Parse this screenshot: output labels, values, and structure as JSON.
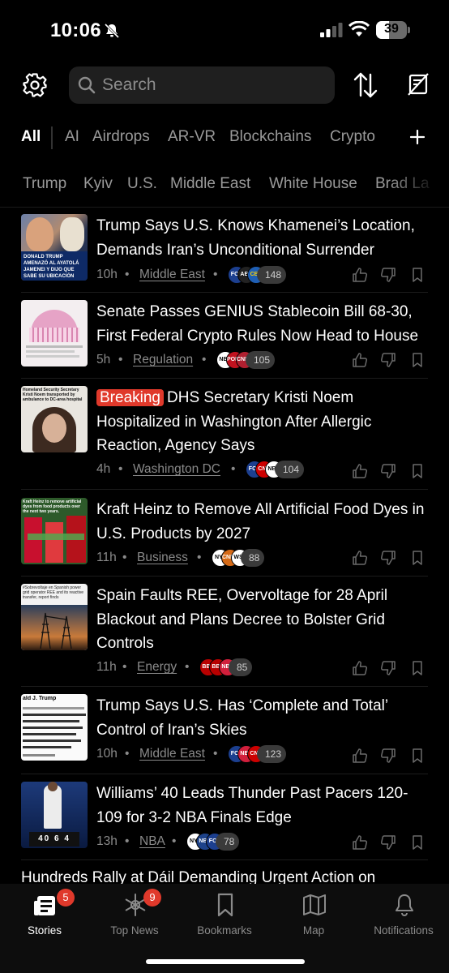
{
  "status_bar": {
    "time": "10:06",
    "battery": "39"
  },
  "search": {
    "placeholder": "Search"
  },
  "tabs": [
    "All",
    "AI",
    "Airdrops",
    "AR-VR",
    "Blockchains",
    "Crypto"
  ],
  "chips": [
    "Trump",
    "Kyiv",
    "U.S.",
    "Middle East",
    "White House",
    "Brad La"
  ],
  "stories": [
    {
      "badge": "",
      "headline": "Trump Says U.S. Knows Khamenei’s Location, Demands Iran’s Unconditional Surrender",
      "age": "10h",
      "topic": "Middle East",
      "sources": [
        "FOX",
        "ABC",
        "CBS"
      ],
      "source_count": "148",
      "thumb_caption": "DONALD TRUMP AMENAZÓ AL AYATOLÁ JAMENEI Y DIJO QUE SABE SU UBICACIÓN"
    },
    {
      "badge": "",
      "headline": "Senate Passes GENIUS Stablecoin Bill 68-30, First Federal Crypto Rules Now Head to House",
      "age": "5h",
      "topic": "Regulation",
      "sources": [
        "NBC",
        "POLIT",
        "CNBC"
      ],
      "source_count": "105",
      "thumb_caption": ""
    },
    {
      "badge": "Breaking",
      "headline": "DHS Secretary Kristi Noem Hospitalized in Washington After Allergic Reaction, Agency Says",
      "age": "4h",
      "topic": "Washington DC",
      "sources": [
        "FOX",
        "CNN",
        "NBC"
      ],
      "source_count": "104",
      "thumb_caption": "Homeland Security Secretary Kristi Noem transported by ambulance to DC-area hospital"
    },
    {
      "badge": "",
      "headline": "Kraft Heinz to Remove All Artificial Food Dyes in U.S. Products by 2027",
      "age": "11h",
      "topic": "Business",
      "sources": [
        "NYT",
        "CNBC",
        "WSJ"
      ],
      "source_count": "88",
      "thumb_caption": "Kraft Heinz to remove artificial dyes from food products over the next two years."
    },
    {
      "badge": "",
      "headline": "Spain Faults REE, Overvoltage for 28 April Blackout and Plans Decree to Bolster Grid Controls",
      "age": "11h",
      "topic": "Energy",
      "sources": [
        "BBC",
        "BBC",
        "NBC"
      ],
      "source_count": "85",
      "thumb_caption": "#Sobrevoltaje en Spanish power grid operator REE and its reactive transfer, report finds"
    },
    {
      "badge": "",
      "headline": "Trump Says U.S. Has ‘Complete and Total’ Control of Iran’s Skies",
      "age": "10h",
      "topic": "Middle East",
      "sources": [
        "FOX",
        "NBC",
        "CNN"
      ],
      "source_count": "123",
      "thumb_caption": "ald J. Trump"
    },
    {
      "badge": "",
      "headline": "Williams’ 40 Leads Thunder Past Pacers 120-109 for 3-2 NBA Finals Edge",
      "age": "13h",
      "topic": "NBA",
      "sources": [
        "NYT",
        "NBA",
        "FOX"
      ],
      "source_count": "78",
      "thumb_caption": "40 6 4"
    }
  ],
  "teaser": "Hundreds Rally at Dáil Demanding Urgent Action on",
  "tabbar": [
    {
      "label": "Stories",
      "badge": "5"
    },
    {
      "label": "Top News",
      "badge": "9"
    },
    {
      "label": "Bookmarks",
      "badge": ""
    },
    {
      "label": "Map",
      "badge": ""
    },
    {
      "label": "Notifications",
      "badge": ""
    }
  ],
  "colors": {
    "accent_red": "#e0392b",
    "background": "#000000",
    "muted": "#8a8a8a"
  }
}
